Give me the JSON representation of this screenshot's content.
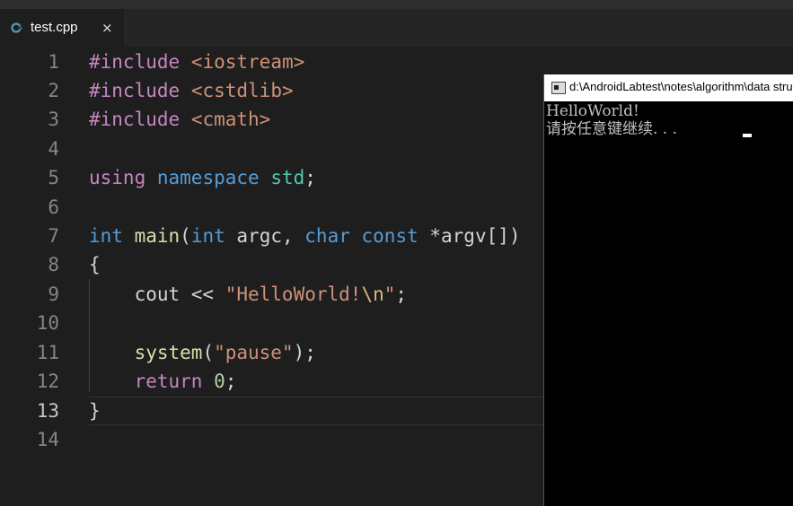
{
  "tab": {
    "filename": "test.cpp",
    "close_glyph": "×",
    "icon": "cpp-file-icon"
  },
  "editor": {
    "line_numbers": [
      "1",
      "2",
      "3",
      "4",
      "5",
      "6",
      "7",
      "8",
      "9",
      "10",
      "11",
      "12",
      "13",
      "14"
    ],
    "active_line": 13,
    "code": {
      "l1": {
        "directive": "#include",
        "header": "<iostream>"
      },
      "l2": {
        "directive": "#include",
        "header": "<cstdlib>"
      },
      "l3": {
        "directive": "#include",
        "header": "<cmath>"
      },
      "l5": {
        "using": "using",
        "namespace": "namespace",
        "std": "std",
        "semi": ";"
      },
      "l7": {
        "int1": "int",
        "main": "main",
        "open": "(",
        "int2": "int",
        "argc": " argc, ",
        "char": "char",
        "const": "const",
        "rest": " *argv[])"
      },
      "l8": {
        "brace": "{"
      },
      "l9": {
        "cout": "    cout << ",
        "str_a": "\"HelloWorld!",
        "esc": "\\n",
        "str_b": "\"",
        "semi": ";"
      },
      "l11": {
        "indent": "    ",
        "system": "system",
        "open": "(",
        "str": "\"pause\"",
        "close": ");"
      },
      "l12": {
        "ret": "return",
        "zero": "0",
        "semi": ";",
        "indent": "    ",
        "space": " "
      },
      "l13": {
        "brace": "}"
      }
    }
  },
  "console": {
    "title": "d:\\AndroidLabtest\\notes\\algorithm\\data structures",
    "output": [
      "HelloWorld!",
      "请按任意键继续. . . "
    ],
    "colors": {
      "background": "#000000",
      "text": "#c0c0c0"
    }
  },
  "colors": {
    "editor_bg": "#1e1e1e",
    "preprocessor": "#c586c0",
    "string": "#ce9178",
    "keyword": "#569cd6",
    "type": "#4ec9b0",
    "function": "#dcdcaa",
    "number": "#b5cea8"
  }
}
